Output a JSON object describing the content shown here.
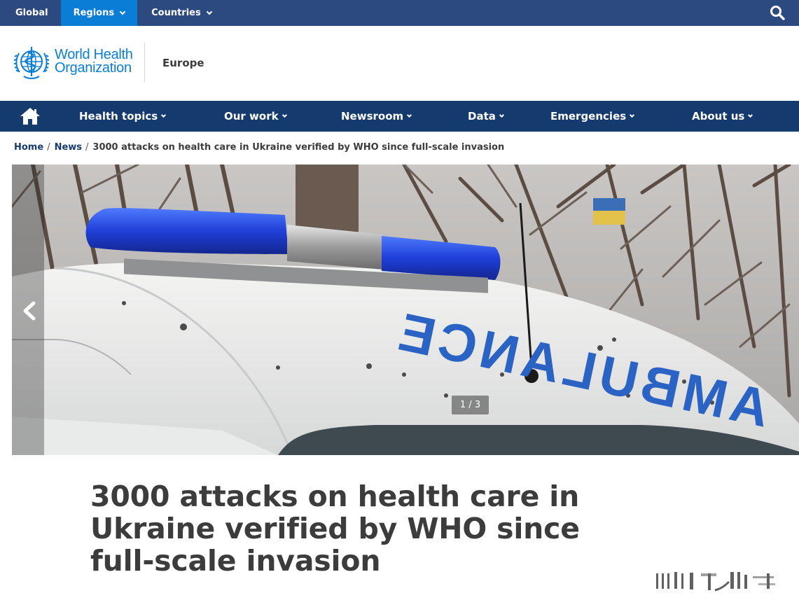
{
  "topbar": {
    "items": [
      {
        "label": "Global",
        "active": false
      },
      {
        "label": "Regions",
        "active": true
      },
      {
        "label": "Countries",
        "active": false
      }
    ],
    "search_icon": "search-icon",
    "colors": {
      "bar": "#2d4a80",
      "active": "#0a7ed6"
    }
  },
  "logo": {
    "line1": "World Health",
    "line2": "Organization",
    "region": "Europe",
    "color": "#0a7ed6"
  },
  "mainnav": {
    "home_icon": "home-icon",
    "items": [
      {
        "label": "Health topics"
      },
      {
        "label": "Our work"
      },
      {
        "label": "Newsroom"
      },
      {
        "label": "Data"
      },
      {
        "label": "Emergencies"
      },
      {
        "label": "About us"
      }
    ],
    "color": "#153a6e"
  },
  "breadcrumb": {
    "items": [
      {
        "label": "Home"
      },
      {
        "label": "News"
      }
    ],
    "current": "3000 attacks on health care in Ukraine verified by WHO since full-scale invasion"
  },
  "hero": {
    "image_text": "AMBULANCE",
    "counter": "1 / 3",
    "prev_icon": "chevron-left-icon"
  },
  "article": {
    "title": "3000 attacks on health care in Ukraine verified by WHO since full-scale invasion"
  }
}
